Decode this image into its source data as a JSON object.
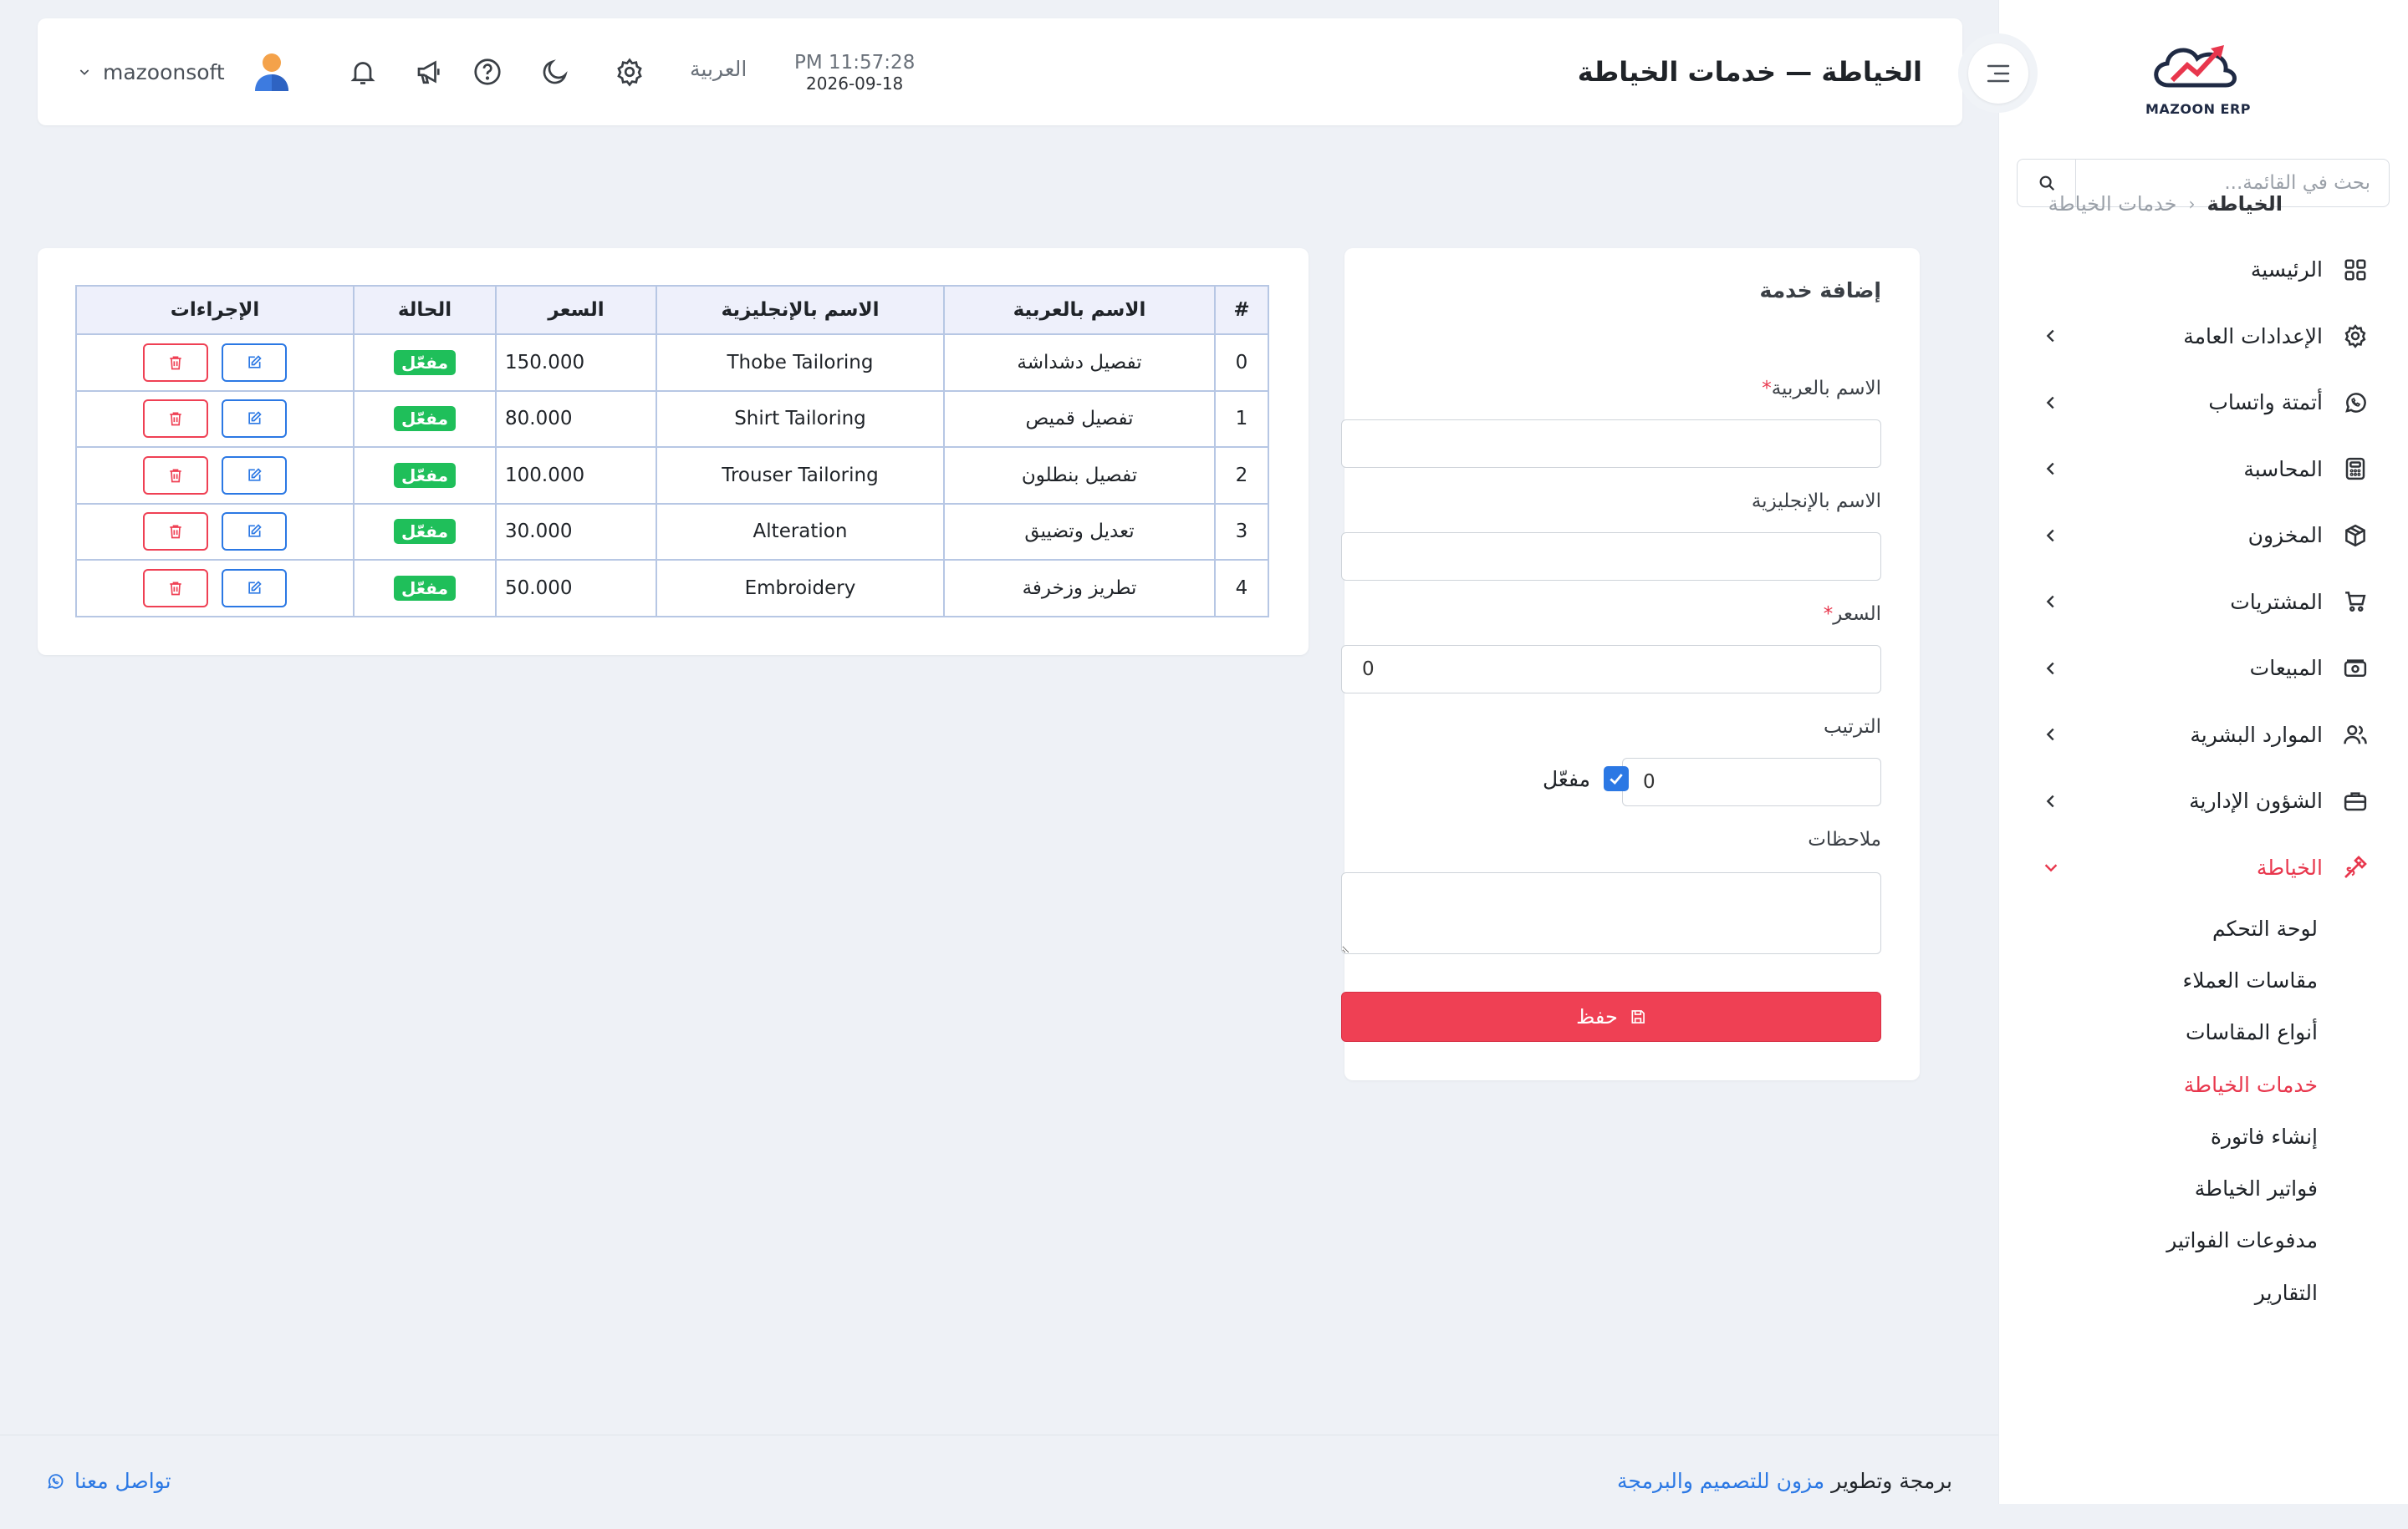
{
  "brand": {
    "logo_text": "MAZOON ERP"
  },
  "search": {
    "placeholder": "بحث في القائمة..."
  },
  "nav": {
    "items": [
      {
        "label": "الرئيسية",
        "icon": "grid-icon",
        "expandable": false
      },
      {
        "label": "الإعدادات العامة",
        "icon": "gear-icon",
        "expandable": true
      },
      {
        "label": "أتمتة واتساب",
        "icon": "whatsapp-icon",
        "expandable": true
      },
      {
        "label": "المحاسبة",
        "icon": "calculator-icon",
        "expandable": true
      },
      {
        "label": "المخزون",
        "icon": "box-icon",
        "expandable": true
      },
      {
        "label": "المشتريات",
        "icon": "cart-icon",
        "expandable": true
      },
      {
        "label": "المبيعات",
        "icon": "cash-icon",
        "expandable": true
      },
      {
        "label": "الموارد البشرية",
        "icon": "users-icon",
        "expandable": true
      },
      {
        "label": "الشؤون الإدارية",
        "icon": "briefcase-icon",
        "expandable": true
      }
    ],
    "active_group": {
      "label": "الخياطة",
      "icon": "needle-icon",
      "color": "#e8374d"
    },
    "sub_items": [
      {
        "label": "لوحة التحكم",
        "active": false
      },
      {
        "label": "مقاسات العملاء",
        "active": false
      },
      {
        "label": "أنواع المقاسات",
        "active": false
      },
      {
        "label": "خدمات الخياطة",
        "active": true
      },
      {
        "label": "إنشاء فاتورة",
        "active": false
      },
      {
        "label": "فواتير الخياطة",
        "active": false
      },
      {
        "label": "مدفوعات الفواتير",
        "active": false
      },
      {
        "label": "التقارير",
        "active": false
      }
    ]
  },
  "header": {
    "title": "الخياطة — خدمات الخياطة",
    "time": "PM 11:57:28",
    "date": "2026-09-18",
    "language": "العربية",
    "username": "mazoonsoft"
  },
  "breadcrumb": {
    "root": "الخياطة",
    "current": "خدمات الخياطة"
  },
  "form": {
    "title": "إضافة خدمة",
    "name_ar_label": "الاسم بالعربية",
    "name_ar_value": "",
    "name_en_label": "الاسم بالإنجليزية",
    "name_en_value": "",
    "price_label": "السعر",
    "price_value": "0",
    "order_label": "الترتيب",
    "order_value": "0",
    "enabled_label": "مفعّل",
    "enabled_checked": true,
    "notes_label": "ملاحظات",
    "notes_value": "",
    "save_label": "حفظ",
    "required_mark": "*"
  },
  "table": {
    "headers": [
      "#",
      "الاسم بالعربية",
      "الاسم بالإنجليزية",
      "السعر",
      "الحالة",
      "الإجراءات"
    ],
    "rows": [
      {
        "index": "0",
        "name_ar": "تفصيل دشداشة",
        "name_en": "Thobe Tailoring",
        "price": "150.000",
        "status": "مفعّل"
      },
      {
        "index": "1",
        "name_ar": "تفصيل قميص",
        "name_en": "Shirt Tailoring",
        "price": "80.000",
        "status": "مفعّل"
      },
      {
        "index": "2",
        "name_ar": "تفصيل بنطلون",
        "name_en": "Trouser Tailoring",
        "price": "100.000",
        "status": "مفعّل"
      },
      {
        "index": "3",
        "name_ar": "تعديل وتضييق",
        "name_en": "Alteration",
        "price": "30.000",
        "status": "مفعّل"
      },
      {
        "index": "4",
        "name_ar": "تطريز وزخرفة",
        "name_en": "Embroidery",
        "price": "50.000",
        "status": "مفعّل"
      }
    ]
  },
  "footer": {
    "credit_prefix": "برمجة وتطوير ",
    "credit_link": "مزون للتصميم والبرمجة",
    "contact": "تواصل معنا"
  },
  "colors": {
    "accent": "#e8374d",
    "primary": "#2b78e4",
    "success": "#1fbf5a",
    "danger": "#ef4054"
  }
}
